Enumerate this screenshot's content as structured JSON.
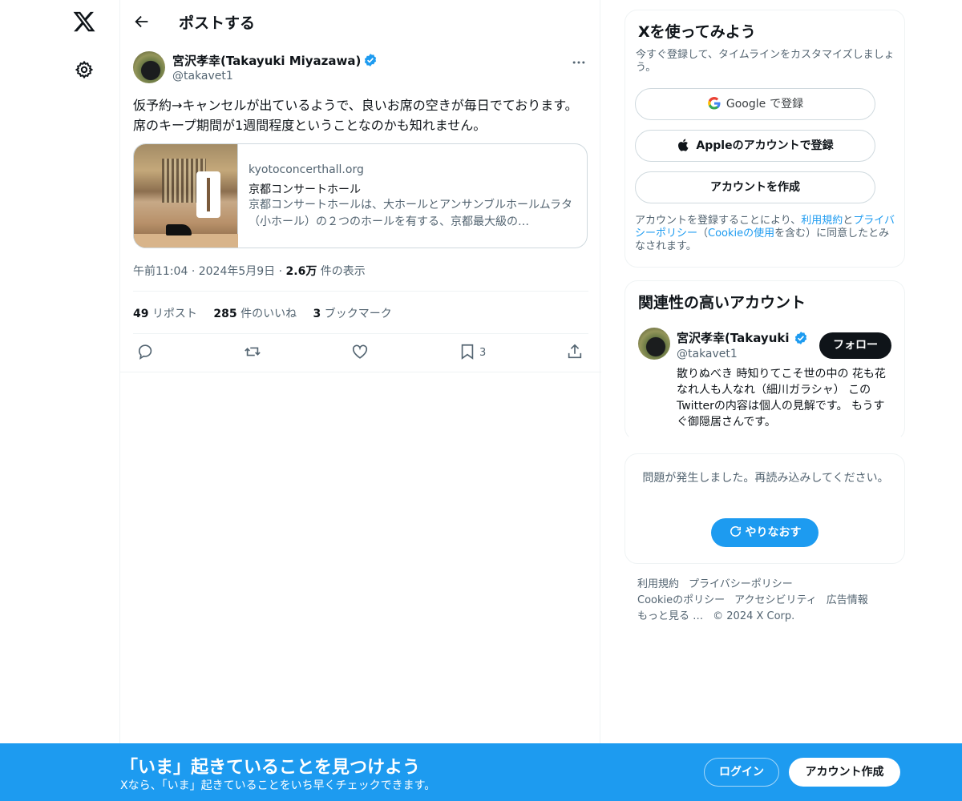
{
  "nav": {
    "logo_icon": "x-logo-icon",
    "settings_icon": "gear-icon"
  },
  "header": {
    "title": "ポストする"
  },
  "tweet": {
    "author_name": "宮沢孝幸(Takayuki Miyazawa)",
    "author_handle": "@takavet1",
    "text": "仮予約→キャンセルが出ているようで、良いお席の空きが毎日でております。席のキープ期間が1週間程度ということなのかも知れません。",
    "card": {
      "domain": "kyotoconcerthall.org",
      "title": "京都コンサートホール",
      "description": "京都コンサートホールは、大ホールとアンサンブルホールムラタ（小ホール）の２つのホールを有する、京都最大級の…"
    },
    "time": "午前11:04",
    "date": "2024年5月9日",
    "views_count": "2.6万",
    "views_label": "件の表示",
    "reposts_count": "49",
    "reposts_label": "リポスト",
    "likes_count": "285",
    "likes_label": "件のいいね",
    "bookmarks_count": "3",
    "bookmarks_label": "ブックマーク",
    "bookmark_action_count": "3"
  },
  "signup_box": {
    "title": "Xを使ってみよう",
    "subtitle": "今すぐ登録して、タイムラインをカスタマイズしましょう。",
    "google_brand": "Google",
    "google_label": "で登録",
    "apple_label": "Appleのアカウントで登録",
    "create_label": "アカウントを作成",
    "legal_pre": "アカウントを登録することにより、",
    "legal_terms": "利用規約",
    "legal_and": "と",
    "legal_privacy": "プライバシーポリシー",
    "legal_paren_open": "（",
    "legal_cookie": "Cookieの使用",
    "legal_post": "を含む）に同意したとみなされます。"
  },
  "related": {
    "title": "関連性の高いアカウント",
    "name": "宮沢孝幸(Takayuki M",
    "handle": "@takavet1",
    "follow_label": "フォロー",
    "bio": "散りぬべき 時知りてこそ世の中の 花も花なれ人も人なれ（細川ガラシャ） このTwitterの内容は個人の見解です。 もうすぐ御隠居さんです。"
  },
  "error_box": {
    "message": "問題が発生しました。再読み込みしてください。",
    "retry_label": "やりなおす"
  },
  "footer": {
    "links": [
      "利用規約",
      "プライバシーポリシー",
      "Cookieのポリシー",
      "アクセシビリティ",
      "広告情報",
      "もっと見る …",
      "© 2024 X Corp."
    ]
  },
  "bottom_bar": {
    "title": "「いま」起きていることを見つけよう",
    "subtitle": "Xなら、「いま」起きていることをいち早くチェックできます。",
    "login_label": "ログイン",
    "signup_label": "アカウント作成"
  },
  "colors": {
    "accent": "#1d9bf0",
    "text": "#0f1419",
    "muted": "#536471",
    "border": "#eff3f4"
  }
}
